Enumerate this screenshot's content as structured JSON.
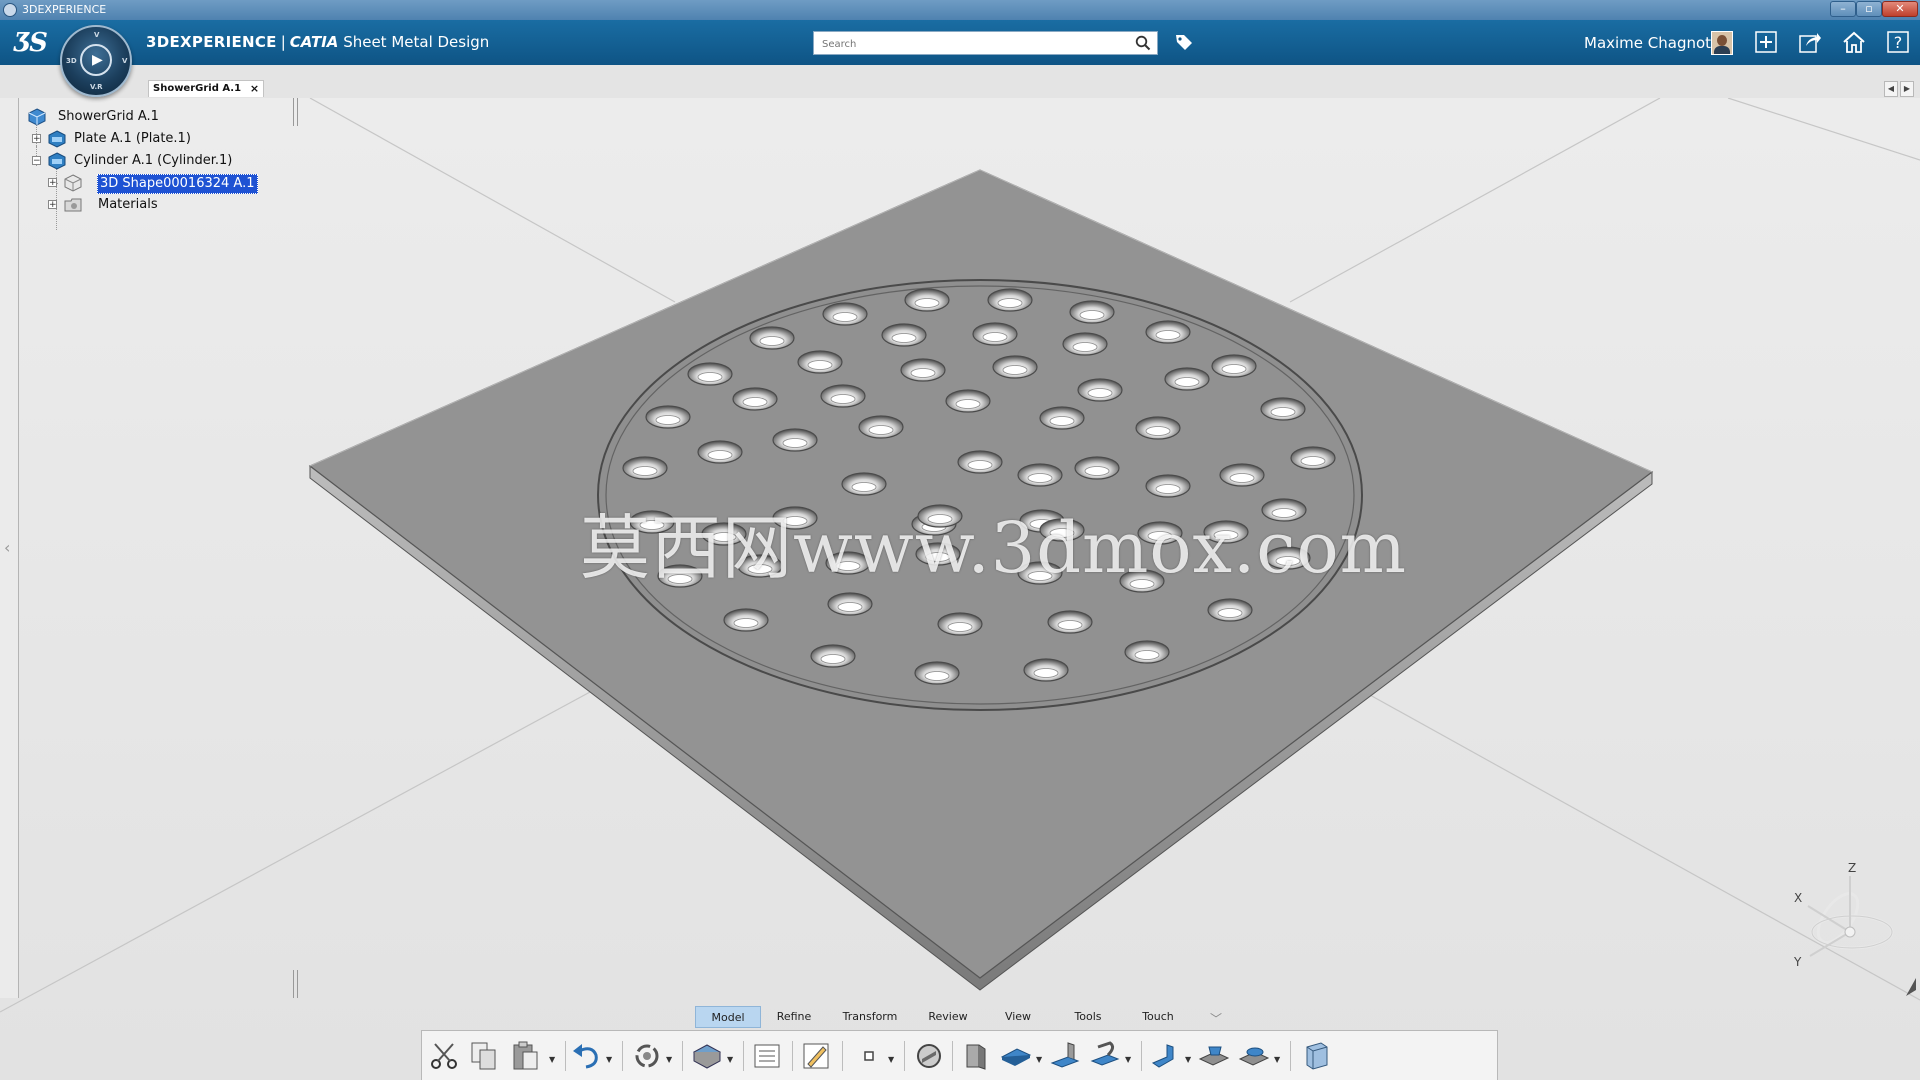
{
  "window": {
    "title": "3DEXPERIENCE"
  },
  "topbar": {
    "brand": "3DEXPERIENCE",
    "separator": "|",
    "catia": "CATIA",
    "app": "Sheet Metal Design",
    "search_placeholder": "Search",
    "user_name": "Maxime Chagnot",
    "compass_labels": {
      "top": "V",
      "left": "3D",
      "right": "V",
      "bottom": "V.R"
    }
  },
  "document_tab": {
    "label": "ShowerGrid A.1",
    "close": "×"
  },
  "tree": {
    "root": "ShowerGrid A.1",
    "items": [
      {
        "label": "Plate A.1 (Plate.1)",
        "expander": "+"
      },
      {
        "label": "Cylinder A.1 (Cylinder.1)",
        "expander": "−"
      },
      {
        "label": "3D Shape00016324 A.1",
        "expander": "+",
        "selected": true
      },
      {
        "label": "Materials",
        "expander": "+"
      }
    ]
  },
  "watermark": "莫西网www.3dmox.com",
  "triad": {
    "x": "X",
    "y": "Y",
    "z": "Z"
  },
  "sections": {
    "active": "Model",
    "tabs": [
      "Model",
      "Refine",
      "Transform",
      "Review",
      "View",
      "Tools",
      "Touch"
    ]
  },
  "colors": {
    "topbar": "#0e5485",
    "plate": "#929292",
    "selection": "#1e52d3",
    "active_section": "#b9d6f0"
  },
  "icons": {
    "actions": [
      "cut-icon",
      "copy-icon",
      "paste-icon",
      "undo-icon",
      "update-icon",
      "publish-icon",
      "properties-icon",
      "sketch-icon",
      "point-icon",
      "sheet-metal-parameters-icon",
      "wall-icon",
      "plate-icon",
      "flange-icon",
      "hem-icon",
      "bend-icon",
      "stamp-icon",
      "emboss-icon",
      "3d-view-icon"
    ]
  }
}
